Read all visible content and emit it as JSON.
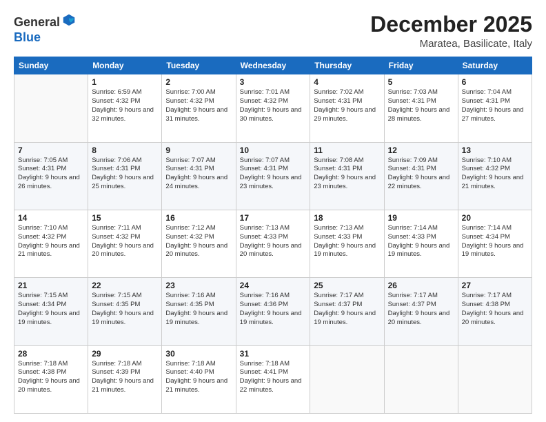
{
  "logo": {
    "general": "General",
    "blue": "Blue"
  },
  "header": {
    "month": "December 2025",
    "location": "Maratea, Basilicate, Italy"
  },
  "weekdays": [
    "Sunday",
    "Monday",
    "Tuesday",
    "Wednesday",
    "Thursday",
    "Friday",
    "Saturday"
  ],
  "weeks": [
    [
      {
        "day": "",
        "sunrise": "",
        "sunset": "",
        "daylight": ""
      },
      {
        "day": "1",
        "sunrise": "Sunrise: 6:59 AM",
        "sunset": "Sunset: 4:32 PM",
        "daylight": "Daylight: 9 hours and 32 minutes."
      },
      {
        "day": "2",
        "sunrise": "Sunrise: 7:00 AM",
        "sunset": "Sunset: 4:32 PM",
        "daylight": "Daylight: 9 hours and 31 minutes."
      },
      {
        "day": "3",
        "sunrise": "Sunrise: 7:01 AM",
        "sunset": "Sunset: 4:32 PM",
        "daylight": "Daylight: 9 hours and 30 minutes."
      },
      {
        "day": "4",
        "sunrise": "Sunrise: 7:02 AM",
        "sunset": "Sunset: 4:31 PM",
        "daylight": "Daylight: 9 hours and 29 minutes."
      },
      {
        "day": "5",
        "sunrise": "Sunrise: 7:03 AM",
        "sunset": "Sunset: 4:31 PM",
        "daylight": "Daylight: 9 hours and 28 minutes."
      },
      {
        "day": "6",
        "sunrise": "Sunrise: 7:04 AM",
        "sunset": "Sunset: 4:31 PM",
        "daylight": "Daylight: 9 hours and 27 minutes."
      }
    ],
    [
      {
        "day": "7",
        "sunrise": "Sunrise: 7:05 AM",
        "sunset": "Sunset: 4:31 PM",
        "daylight": "Daylight: 9 hours and 26 minutes."
      },
      {
        "day": "8",
        "sunrise": "Sunrise: 7:06 AM",
        "sunset": "Sunset: 4:31 PM",
        "daylight": "Daylight: 9 hours and 25 minutes."
      },
      {
        "day": "9",
        "sunrise": "Sunrise: 7:07 AM",
        "sunset": "Sunset: 4:31 PM",
        "daylight": "Daylight: 9 hours and 24 minutes."
      },
      {
        "day": "10",
        "sunrise": "Sunrise: 7:07 AM",
        "sunset": "Sunset: 4:31 PM",
        "daylight": "Daylight: 9 hours and 23 minutes."
      },
      {
        "day": "11",
        "sunrise": "Sunrise: 7:08 AM",
        "sunset": "Sunset: 4:31 PM",
        "daylight": "Daylight: 9 hours and 23 minutes."
      },
      {
        "day": "12",
        "sunrise": "Sunrise: 7:09 AM",
        "sunset": "Sunset: 4:31 PM",
        "daylight": "Daylight: 9 hours and 22 minutes."
      },
      {
        "day": "13",
        "sunrise": "Sunrise: 7:10 AM",
        "sunset": "Sunset: 4:32 PM",
        "daylight": "Daylight: 9 hours and 21 minutes."
      }
    ],
    [
      {
        "day": "14",
        "sunrise": "Sunrise: 7:10 AM",
        "sunset": "Sunset: 4:32 PM",
        "daylight": "Daylight: 9 hours and 21 minutes."
      },
      {
        "day": "15",
        "sunrise": "Sunrise: 7:11 AM",
        "sunset": "Sunset: 4:32 PM",
        "daylight": "Daylight: 9 hours and 20 minutes."
      },
      {
        "day": "16",
        "sunrise": "Sunrise: 7:12 AM",
        "sunset": "Sunset: 4:32 PM",
        "daylight": "Daylight: 9 hours and 20 minutes."
      },
      {
        "day": "17",
        "sunrise": "Sunrise: 7:13 AM",
        "sunset": "Sunset: 4:33 PM",
        "daylight": "Daylight: 9 hours and 20 minutes."
      },
      {
        "day": "18",
        "sunrise": "Sunrise: 7:13 AM",
        "sunset": "Sunset: 4:33 PM",
        "daylight": "Daylight: 9 hours and 19 minutes."
      },
      {
        "day": "19",
        "sunrise": "Sunrise: 7:14 AM",
        "sunset": "Sunset: 4:33 PM",
        "daylight": "Daylight: 9 hours and 19 minutes."
      },
      {
        "day": "20",
        "sunrise": "Sunrise: 7:14 AM",
        "sunset": "Sunset: 4:34 PM",
        "daylight": "Daylight: 9 hours and 19 minutes."
      }
    ],
    [
      {
        "day": "21",
        "sunrise": "Sunrise: 7:15 AM",
        "sunset": "Sunset: 4:34 PM",
        "daylight": "Daylight: 9 hours and 19 minutes."
      },
      {
        "day": "22",
        "sunrise": "Sunrise: 7:15 AM",
        "sunset": "Sunset: 4:35 PM",
        "daylight": "Daylight: 9 hours and 19 minutes."
      },
      {
        "day": "23",
        "sunrise": "Sunrise: 7:16 AM",
        "sunset": "Sunset: 4:35 PM",
        "daylight": "Daylight: 9 hours and 19 minutes."
      },
      {
        "day": "24",
        "sunrise": "Sunrise: 7:16 AM",
        "sunset": "Sunset: 4:36 PM",
        "daylight": "Daylight: 9 hours and 19 minutes."
      },
      {
        "day": "25",
        "sunrise": "Sunrise: 7:17 AM",
        "sunset": "Sunset: 4:37 PM",
        "daylight": "Daylight: 9 hours and 19 minutes."
      },
      {
        "day": "26",
        "sunrise": "Sunrise: 7:17 AM",
        "sunset": "Sunset: 4:37 PM",
        "daylight": "Daylight: 9 hours and 20 minutes."
      },
      {
        "day": "27",
        "sunrise": "Sunrise: 7:17 AM",
        "sunset": "Sunset: 4:38 PM",
        "daylight": "Daylight: 9 hours and 20 minutes."
      }
    ],
    [
      {
        "day": "28",
        "sunrise": "Sunrise: 7:18 AM",
        "sunset": "Sunset: 4:38 PM",
        "daylight": "Daylight: 9 hours and 20 minutes."
      },
      {
        "day": "29",
        "sunrise": "Sunrise: 7:18 AM",
        "sunset": "Sunset: 4:39 PM",
        "daylight": "Daylight: 9 hours and 21 minutes."
      },
      {
        "day": "30",
        "sunrise": "Sunrise: 7:18 AM",
        "sunset": "Sunset: 4:40 PM",
        "daylight": "Daylight: 9 hours and 21 minutes."
      },
      {
        "day": "31",
        "sunrise": "Sunrise: 7:18 AM",
        "sunset": "Sunset: 4:41 PM",
        "daylight": "Daylight: 9 hours and 22 minutes."
      },
      {
        "day": "",
        "sunrise": "",
        "sunset": "",
        "daylight": ""
      },
      {
        "day": "",
        "sunrise": "",
        "sunset": "",
        "daylight": ""
      },
      {
        "day": "",
        "sunrise": "",
        "sunset": "",
        "daylight": ""
      }
    ]
  ]
}
